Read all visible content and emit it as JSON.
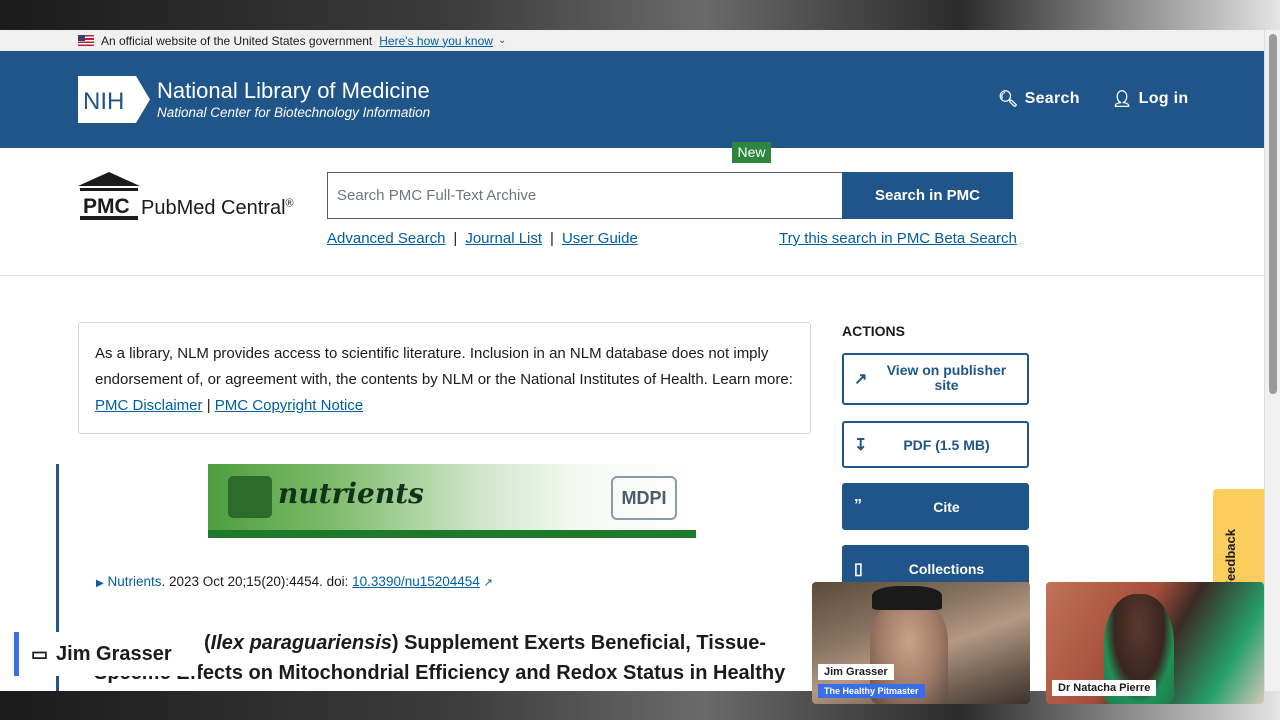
{
  "gov_banner": {
    "text": "An official website of the United States government",
    "link": "Here's how you know"
  },
  "header": {
    "logo": "NIH",
    "title": "National Library of Medicine",
    "subtitle": "National Center for Biotechnology Information",
    "search_label": "Search",
    "login_label": "Log in"
  },
  "pmc": {
    "logo_prefix": "PMC",
    "logo_name": "PubMed Central",
    "logo_mark": "®",
    "search_placeholder": "Search PMC Full-Text Archive",
    "search_button": "Search in PMC",
    "links": [
      "Advanced Search",
      "Journal List",
      "User Guide"
    ],
    "new_badge": "New",
    "beta_link": "Try this search in PMC Beta Search"
  },
  "disclaimer": {
    "text": "As a library, NLM provides access to scientific literature. Inclusion in an NLM database does not imply endorsement of, or agreement with, the contents by NLM or the National Institutes of Health.",
    "learn_more": "Learn more:",
    "link1": "PMC Disclaimer",
    "divider": "|",
    "link2": "PMC Copyright Notice"
  },
  "article": {
    "journal_banner_name": "nutrients",
    "publisher_logo": "MDPI",
    "journal": "Nutrients",
    "citation": ". 2023 Oct 20;15(20):4454. doi:",
    "doi": "10.3390/nu15204454",
    "title_line1_italic": "Ilex paraguariensis",
    "title_line1": ") Supplement Exerts Beneficial, Tissue-",
    "title_line2": "Specific Effects on Mitochondrial Efficiency and Redox Status in Healthy"
  },
  "actions": {
    "heading": "ACTIONS",
    "view_publisher": "View on publisher site",
    "pdf": "PDF (1.5 MB)",
    "cite": "Cite",
    "collections": "Collections"
  },
  "feedback": "Feedback",
  "call": {
    "presenter_tag": "Jim Grasser",
    "participant1_name": "Jim Grasser",
    "participant1_sub": "The Healthy Pitmaster",
    "participant2_name": "Dr Natacha Pierre"
  },
  "colors": {
    "nlm_blue": "#20558a",
    "link_blue": "#005ea2",
    "new_green": "#2e8540",
    "feedback_yellow": "#facd5c",
    "call_accent": "#3a6ee8"
  }
}
